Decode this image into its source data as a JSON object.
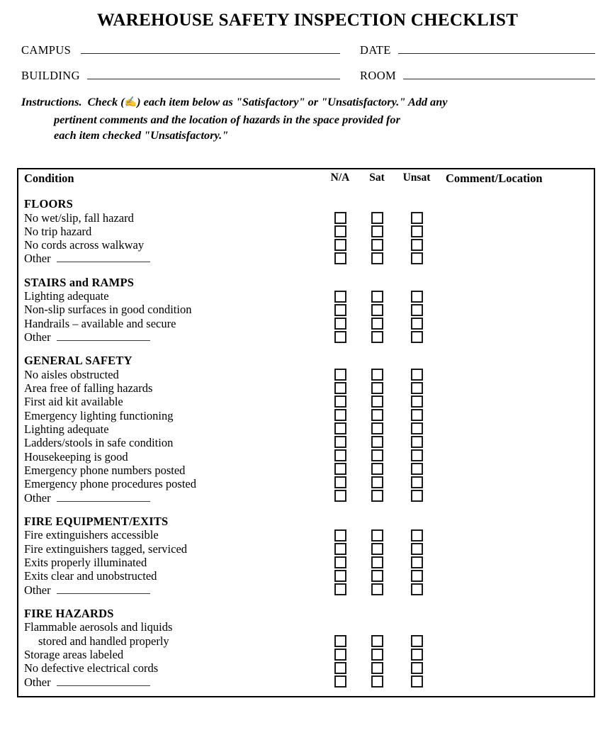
{
  "document": {
    "title": "WAREHOUSE SAFETY INSPECTION CHECKLIST"
  },
  "meta_fields": {
    "campus_label": "CAMPUS",
    "campus_value": "",
    "date_label": "DATE",
    "date_value": "",
    "building_label": "BUILDING",
    "building_value": "",
    "room_label": "ROOM",
    "room_value": ""
  },
  "instructions": {
    "lead": "Instructions.",
    "check_word": "Check",
    "glyph": "✍",
    "line1": "each item below as \"Satisfactory\" or \"Unsatisfactory.\"  Add any",
    "line2": "pertinent comments and the location of hazards in the space provided for",
    "line3": "each item checked \"Unsatisfactory.\""
  },
  "table": {
    "headers": {
      "condition": "Condition",
      "na": "N/A",
      "sat": "Sat",
      "unsat": "Unsat",
      "comment": "Comment/Location"
    },
    "sections": [
      {
        "title": "FLOORS",
        "items": [
          {
            "text": "No wet/slip, fall hazard",
            "continuation": false,
            "has_rule": false
          },
          {
            "text": "No trip hazard",
            "continuation": false,
            "has_rule": false
          },
          {
            "text": "No cords across walkway",
            "continuation": false,
            "has_rule": false
          },
          {
            "text": "Other",
            "continuation": false,
            "has_rule": true
          }
        ],
        "checkbox_rows": 4,
        "comment": ""
      },
      {
        "title": "STAIRS and RAMPS",
        "items": [
          {
            "text": "Lighting adequate",
            "continuation": false,
            "has_rule": false
          },
          {
            "text": "Non-slip surfaces in good condition",
            "continuation": false,
            "has_rule": false
          },
          {
            "text": "Handrails – available and secure",
            "continuation": false,
            "has_rule": false
          },
          {
            "text": "Other",
            "continuation": false,
            "has_rule": true
          }
        ],
        "checkbox_rows": 4,
        "comment": ""
      },
      {
        "title": "GENERAL SAFETY",
        "items": [
          {
            "text": "No aisles obstructed",
            "continuation": false,
            "has_rule": false
          },
          {
            "text": "Area free of falling hazards",
            "continuation": false,
            "has_rule": false
          },
          {
            "text": "First aid kit available",
            "continuation": false,
            "has_rule": false
          },
          {
            "text": "Emergency lighting functioning",
            "continuation": false,
            "has_rule": false
          },
          {
            "text": "Lighting adequate",
            "continuation": false,
            "has_rule": false
          },
          {
            "text": "Ladders/stools in safe condition",
            "continuation": false,
            "has_rule": false
          },
          {
            "text": "Housekeeping is good",
            "continuation": false,
            "has_rule": false
          },
          {
            "text": "Emergency phone numbers posted",
            "continuation": false,
            "has_rule": false
          },
          {
            "text": "Emergency phone procedures posted",
            "continuation": false,
            "has_rule": false
          },
          {
            "text": "Other",
            "continuation": false,
            "has_rule": true
          }
        ],
        "checkbox_rows": 10,
        "comment": ""
      },
      {
        "title": "FIRE EQUIPMENT/EXITS",
        "items": [
          {
            "text": "Fire extinguishers accessible",
            "continuation": false,
            "has_rule": false
          },
          {
            "text": "Fire extinguishers tagged, serviced",
            "continuation": false,
            "has_rule": false
          },
          {
            "text": "Exits properly illuminated",
            "continuation": false,
            "has_rule": false
          },
          {
            "text": "Exits clear and unobstructed",
            "continuation": false,
            "has_rule": false
          },
          {
            "text": "Other",
            "continuation": false,
            "has_rule": true
          }
        ],
        "checkbox_rows": 5,
        "comment": ""
      },
      {
        "title": "FIRE HAZARDS",
        "items": [
          {
            "text": "Flammable aerosols and liquids",
            "continuation": false,
            "has_rule": false
          },
          {
            "text": "stored and handled properly",
            "continuation": true,
            "has_rule": false
          },
          {
            "text": "Storage areas labeled",
            "continuation": false,
            "has_rule": false
          },
          {
            "text": "No defective electrical cords",
            "continuation": false,
            "has_rule": false
          },
          {
            "text": "Other",
            "continuation": false,
            "has_rule": true
          }
        ],
        "checkbox_rows": 4,
        "comment": ""
      }
    ]
  },
  "style": {
    "ink": "#000000",
    "paper": "#ffffff",
    "rule": "#2b2b2b"
  }
}
